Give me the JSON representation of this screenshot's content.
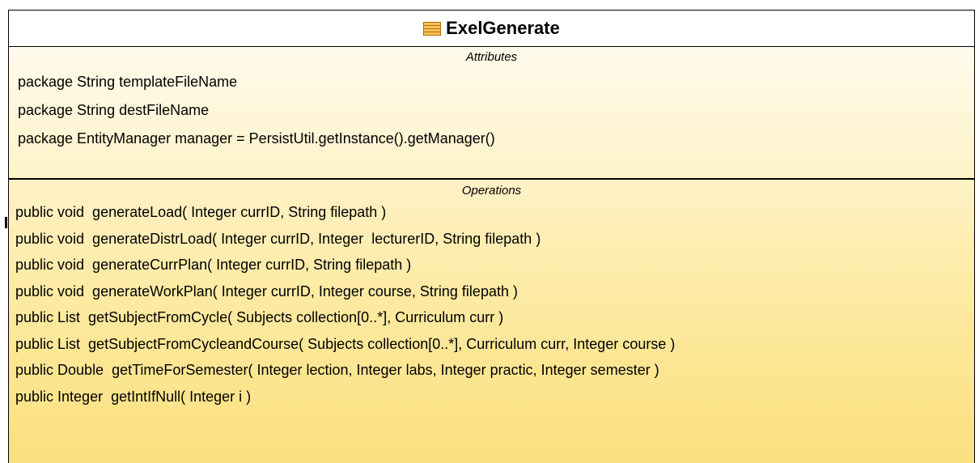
{
  "class": {
    "name": "ExelGenerate",
    "icon": "class-icon",
    "colors": {
      "fill_top": "#ffffff",
      "fill_bottom": "#fbe07e",
      "border": "#000000"
    },
    "attributes_title": "Attributes",
    "attributes": [
      "package String templateFileName",
      "package String destFileName",
      "package EntityManager manager = PersistUtil.getInstance().getManager()"
    ],
    "operations_title": "Operations",
    "operations": [
      "public void  generateLoad( Integer currID, String filepath )",
      "public void  generateDistrLoad( Integer currID, Integer  lecturerID, String filepath )",
      "public void  generateCurrPlan( Integer currID, String filepath )",
      "public void  generateWorkPlan( Integer currID, Integer course, String filepath )",
      "public List  getSubjectFromCycle( Subjects collection[0..*], Curriculum curr )",
      "public List  getSubjectFromCycleandCourse( Subjects collection[0..*], Curriculum curr, Integer course )",
      "public Double  getTimeForSemester( Integer lection, Integer labs, Integer practic, Integer semester )",
      "public Integer  getIntIfNull( Integer i )"
    ]
  }
}
